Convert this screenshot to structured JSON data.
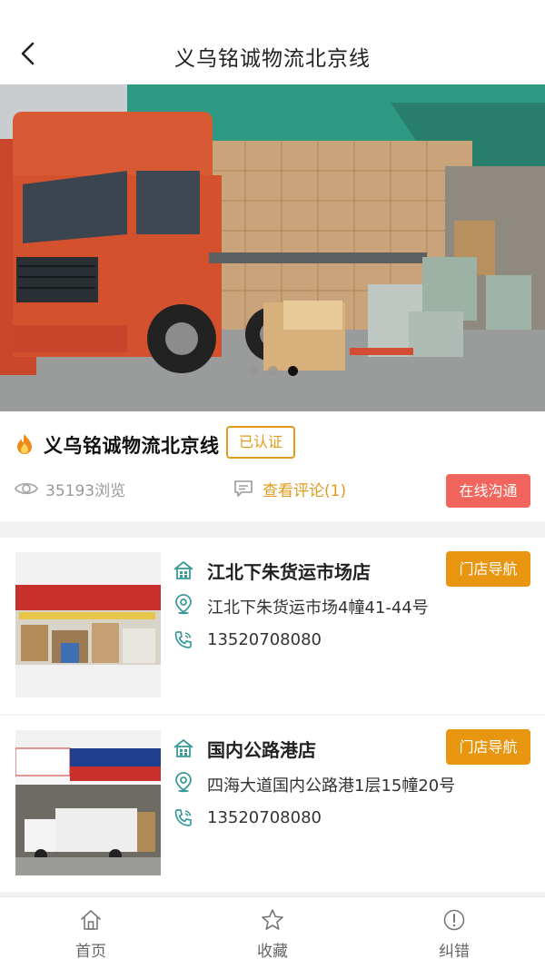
{
  "header": {
    "title": "义乌铭诚物流北京线",
    "back_icon": "chevron-left-icon"
  },
  "banner": {
    "slide_count": 3,
    "active_slide": 3
  },
  "shop": {
    "name": "义乌铭诚物流北京线",
    "verified_label": "已认证",
    "views": "35193浏览",
    "reviews": "查看评论(1)",
    "online_button": "在线沟通"
  },
  "stores": [
    {
      "name": "江北下朱货运市场店",
      "address": "江北下朱货运市场4幢41-44号",
      "phone": "13520708080",
      "nav_button": "门店导航"
    },
    {
      "name": "国内公路港店",
      "address": "四海大道国内公路港1层15幢20号",
      "phone": "13520708080",
      "nav_button": "门店导航"
    }
  ],
  "tabbar": {
    "items": [
      {
        "label": "首页",
        "icon": "home-icon"
      },
      {
        "label": "收藏",
        "icon": "star-icon"
      },
      {
        "label": "纠错",
        "icon": "alert-circle-icon"
      }
    ]
  },
  "colors": {
    "accent": "#e8960f",
    "online": "#f2655c",
    "icon_teal": "#3a9a9a"
  }
}
